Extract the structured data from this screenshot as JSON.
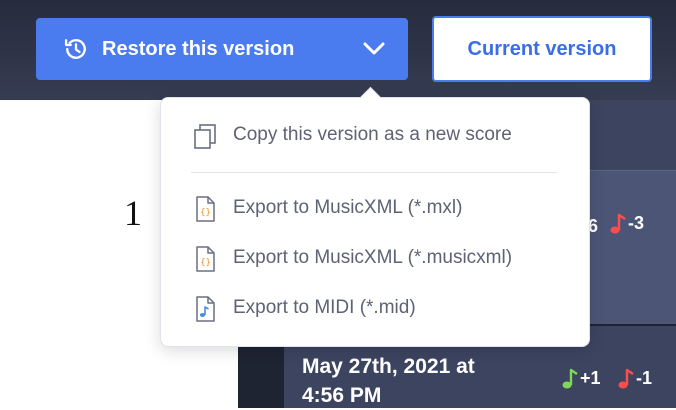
{
  "toolbar": {
    "restore_label": "Restore this version",
    "current_label": "Current version"
  },
  "dropdown": {
    "items": [
      {
        "label": "Copy this version as a new score",
        "icon": "copy-icon"
      },
      {
        "label": "Export to MusicXML (*.mxl)",
        "icon": "musicxml-file-icon"
      },
      {
        "label": "Export to MusicXML (*.musicxml)",
        "icon": "musicxml-file-icon"
      },
      {
        "label": "Export to MIDI (*.mid)",
        "icon": "midi-file-icon"
      }
    ]
  },
  "score": {
    "measure_number": "1"
  },
  "history": {
    "card1": {
      "added_partial": "6",
      "removed": "-3"
    },
    "card2": {
      "date": "May 27th, 2021 at 4:56 PM",
      "added": "+1",
      "removed": "-1"
    }
  },
  "colors": {
    "primary": "#4a7cf0",
    "added_note": "#7ed957",
    "removed_note": "#ff4d4d",
    "file_icon_orange": "#f0912b",
    "file_icon_blue": "#4a8de0"
  }
}
